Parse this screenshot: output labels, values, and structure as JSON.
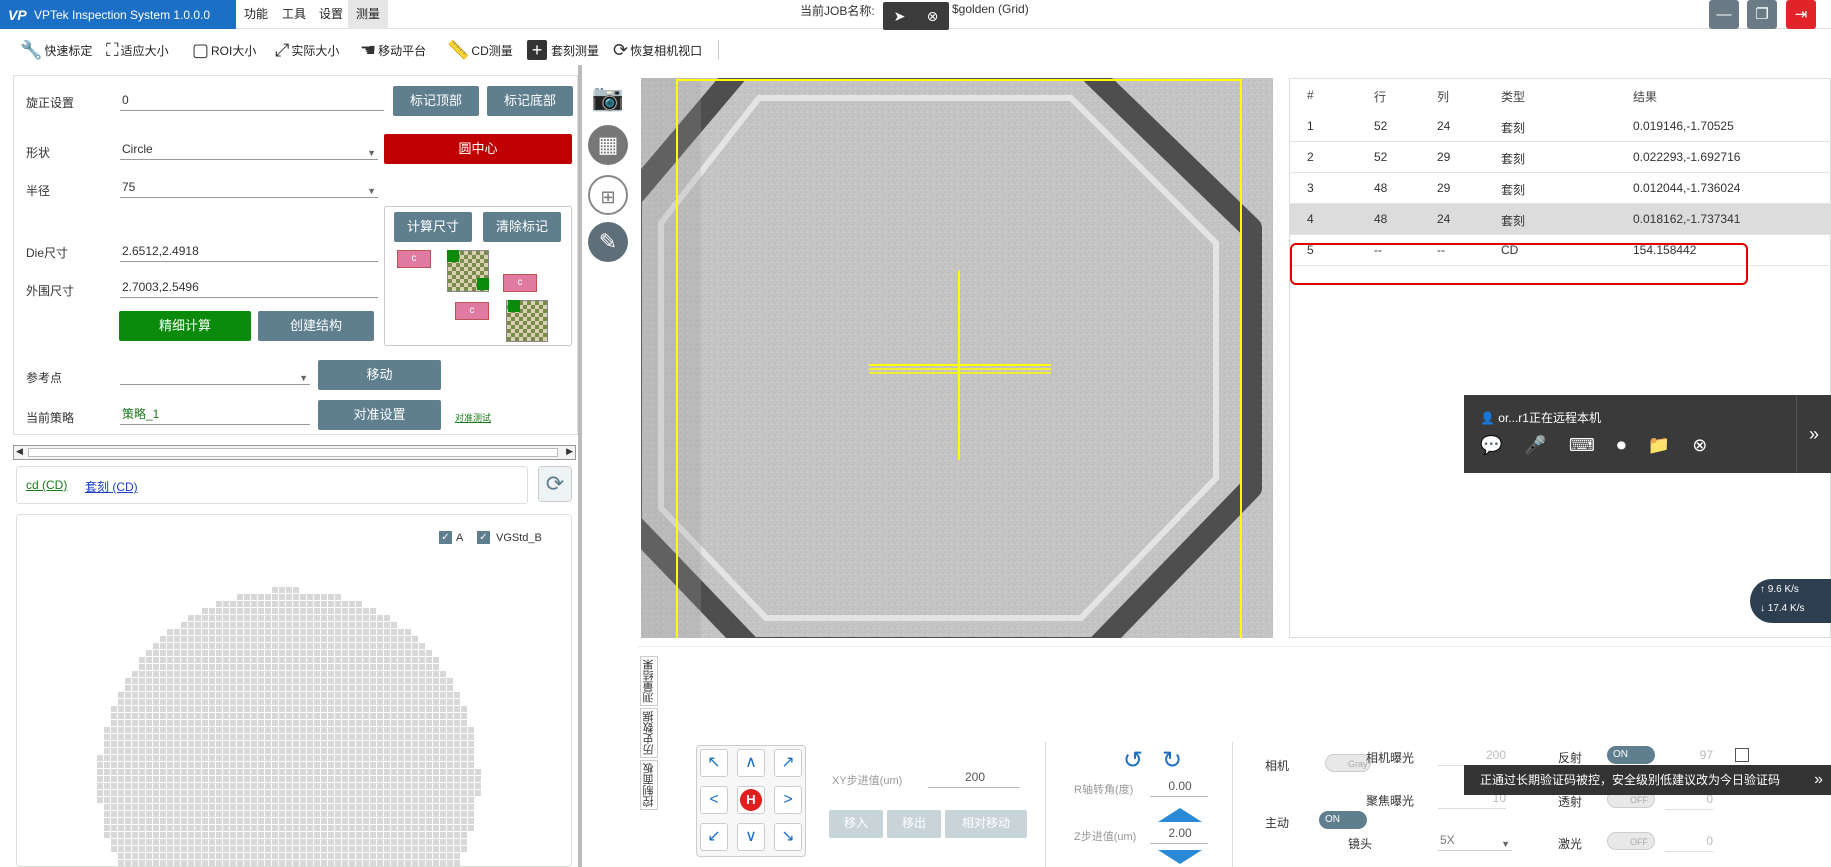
{
  "titlebar": {
    "app_title": "VPTek Inspection System 1.0.0.0",
    "logo": "VP",
    "menus": [
      "功能",
      "工具",
      "设置",
      "测量"
    ],
    "job_label": "当前JOB名称:",
    "job_value": "$golden (Grid)"
  },
  "toolbar": {
    "items": [
      {
        "label": "快速标定",
        "icon": "wrench-icon"
      },
      {
        "label": "适应大小",
        "icon": "fit-icon"
      },
      {
        "label": "ROI大小",
        "icon": "roi-icon"
      },
      {
        "label": "实际大小",
        "icon": "expand-icon"
      },
      {
        "label": "移动平台",
        "icon": "hand-icon"
      },
      {
        "label": "CD测量",
        "icon": "ruler-icon"
      },
      {
        "label": "套刻测量",
        "icon": "plus-icon"
      },
      {
        "label": "恢复相机视口",
        "icon": "restore-icon"
      }
    ]
  },
  "settings": {
    "rotate_label": "旋正设置",
    "rotate_value": "0",
    "mark_top": "标记顶部",
    "mark_bottom": "标记底部",
    "shape_label": "形状",
    "shape_value": "Circle",
    "circle_center": "圆中心",
    "radius_label": "半径",
    "radius_value": "75",
    "calc_size": "计算尺寸",
    "clear_mark": "清除标记",
    "die_label": "Die尺寸",
    "die_value": "2.6512,2.4918",
    "outer_label": "外围尺寸",
    "outer_value": "2.7003,2.5496",
    "fine_calc": "精细计算",
    "create_struct": "创建结构",
    "ref_label": "参考点",
    "ref_value": "",
    "move": "移动",
    "strategy_label": "当前策略",
    "strategy_value": "策略_1",
    "align_settings": "对准设置",
    "align_test": "对准测试",
    "schematic_c": "c"
  },
  "links": [
    "cd (CD)",
    "套刻 (CD)"
  ],
  "wafer": {
    "legend_a": "A",
    "legend_b": "VGStd_B"
  },
  "table": {
    "headers": [
      "#",
      "行",
      "列",
      "类型",
      "结果"
    ],
    "rows": [
      [
        "1",
        "52",
        "24",
        "套刻",
        "0.019146,-1.70525"
      ],
      [
        "2",
        "52",
        "29",
        "套刻",
        "0.022293,-1.692716"
      ],
      [
        "3",
        "48",
        "29",
        "套刻",
        "0.012044,-1.736024"
      ],
      [
        "4",
        "48",
        "24",
        "套刻",
        "0.018162,-1.737341"
      ],
      [
        "5",
        "--",
        "--",
        "CD",
        "154.158442"
      ]
    ]
  },
  "bottom": {
    "tabs": [
      "测量结果",
      "历史数据",
      "控制面板"
    ],
    "xy_label": "XY步进值(um)",
    "xy_value": "200",
    "move_in": "移入",
    "move_out": "移出",
    "rel_move": "相对移动",
    "r_label": "R轴转角(度)",
    "r_value": "0.00",
    "z_label": "Z步进值(um)",
    "z_value": "2.00",
    "camera_label": "相机",
    "camera_toggle": "Gray",
    "active_label": "主动",
    "active_toggle": "ON",
    "exposure_label": "相机曝光",
    "exposure_value": "200",
    "focus_exposure_label": "聚焦曝光",
    "focus_exposure_value": "10",
    "lens_label": "镜头",
    "lens_value": "5X",
    "reflect_label": "反射",
    "reflect_toggle": "ON",
    "reflect_value": "97",
    "transmit_label": "透射",
    "transmit_toggle": "OFF",
    "transmit_value": "0",
    "laser_label": "激光",
    "laser_toggle": "OFF",
    "laser_value": "0",
    "home": "H"
  },
  "remote": {
    "user": "or...r1正在远程本机",
    "notice": "正通过长期验证码被控，安全级别低建议改为今日验证码"
  },
  "net": {
    "up": "9.6",
    "down": "17.4",
    "unit": "K/s"
  },
  "colors": {
    "brand": "#1b6fc4",
    "red": "#c00000",
    "green": "#0a8a0a",
    "btn": "#5f7f8f",
    "crosshair": "#ffff00",
    "highlight": "#e00000"
  }
}
